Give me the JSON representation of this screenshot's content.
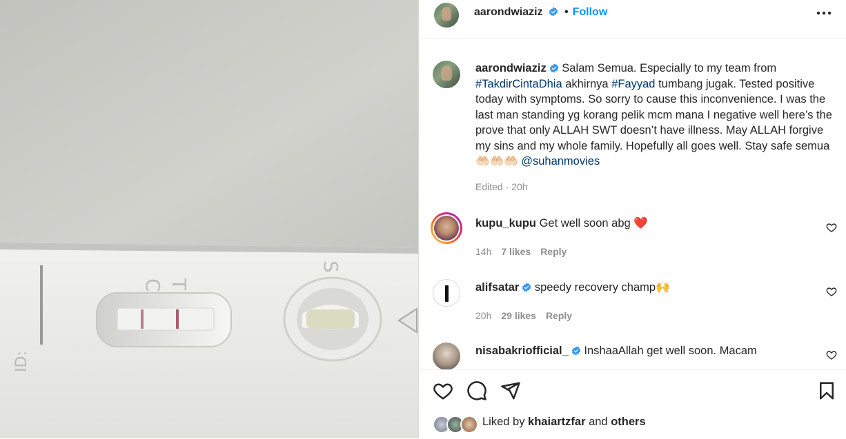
{
  "post": {
    "author": "aarondwiaziz",
    "follow_sep": "•",
    "follow_label": "Follow",
    "caption_author": "aarondwiaziz",
    "caption_1": " Salam Semua. Especially to my team from ",
    "hashtag_1": "#TakdirCintaDhia",
    "caption_2": " akhirnya ",
    "hashtag_2": "#Fayyad",
    "caption_3": " tumbang jugak. Tested positive today with symptoms. So sorry to cause this inconvenience. I was the last man standing yg korang pelik mcm mana I negative well here’s the prove that only ALLAH SWT doesn’t have illness. May ALLAH forgive my sins and my whole family. Hopefully all goes well. Stay safe semua 🤲🏻🤲🏻🤲🏻 ",
    "mention": "@suhanmovies",
    "edited": "Edited",
    "edited_sep": "·",
    "edited_time": "20h"
  },
  "comments": [
    {
      "user": "kupu_kupu",
      "text": " Get well soon abg ",
      "emoji": "❤️",
      "time": "14h",
      "likes": "7 likes",
      "reply": "Reply",
      "verified": false
    },
    {
      "user": "alifsatar",
      "text": " speedy recovery champ🙌",
      "time": "20h",
      "likes": "29 likes",
      "reply": "Reply",
      "verified": true
    },
    {
      "user": "nisabakriofficial_",
      "text": " InshaaAllah get well soon. Macam",
      "verified": true
    }
  ],
  "footer": {
    "liked_by": "Liked by ",
    "liker": "khaiartzfar",
    "and": " and ",
    "others": "others"
  },
  "photo": {
    "test_mark_c": "C",
    "test_mark_t": "T",
    "test_mark_s": "S",
    "test_mark_id": "ID:"
  },
  "colors": {
    "accent": "#0095f6",
    "verified": "#3897f0",
    "link": "#00376b",
    "muted": "#8e8e8e",
    "heart": "#ed4956"
  },
  "icons": [
    "verified-badge-icon",
    "more-options-icon",
    "heart-outline-icon",
    "comment-icon",
    "share-icon",
    "bookmark-icon"
  ]
}
